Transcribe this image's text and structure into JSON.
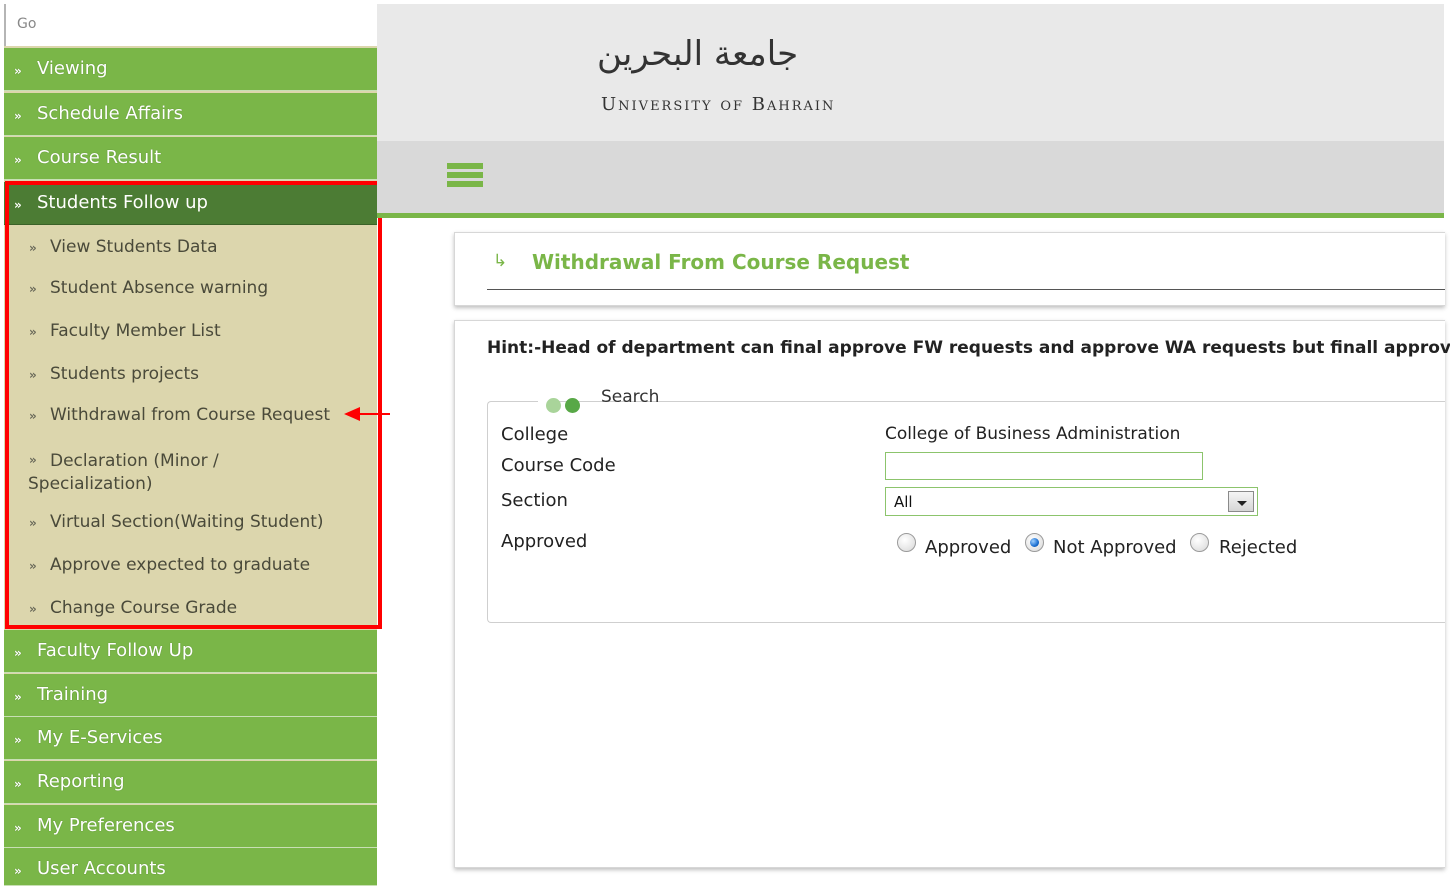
{
  "sidebar": {
    "go_label": "Go",
    "items": [
      {
        "label": "Viewing"
      },
      {
        "label": "Schedule Affairs"
      },
      {
        "label": "Course Result"
      },
      {
        "label": "Students Follow up"
      },
      {
        "label": "Faculty Follow Up"
      },
      {
        "label": "Training"
      },
      {
        "label": "My E-Services"
      },
      {
        "label": "Reporting"
      },
      {
        "label": "My Preferences"
      },
      {
        "label": "User Accounts"
      }
    ],
    "bullet": "»",
    "sub_items": [
      {
        "label": "View Students Data"
      },
      {
        "label": "Student Absence warning"
      },
      {
        "label": "Faculty Member List"
      },
      {
        "label": "Students projects"
      },
      {
        "label": "Withdrawal from Course Request"
      },
      {
        "label": "Declaration (Minor / Specialization)"
      },
      {
        "label": "Virtual Section(Waiting Student)"
      },
      {
        "label": "Approve expected to graduate"
      },
      {
        "label": "Change Course Grade"
      }
    ]
  },
  "header": {
    "arabic_title": "جامعة البحرين",
    "english_title": "University of Bahrain"
  },
  "page": {
    "title_arrow": "↳",
    "title": "Withdrawal From Course Request",
    "hint": "Hint:-Head of department can final approve FW requests and approve WA requests but finall approve"
  },
  "search": {
    "legend": "Search",
    "college_label": "College",
    "college_value": "College of Business Administration",
    "course_code_label": "Course Code",
    "course_code_value": "",
    "section_label": "Section",
    "section_value": "All",
    "approved_label": "Approved",
    "options": [
      {
        "label": "Approved",
        "checked": false
      },
      {
        "label": "Not Approved",
        "checked": true
      },
      {
        "label": "Rejected",
        "checked": false
      }
    ]
  },
  "colors": {
    "menu_green": "#7ab648",
    "active_green": "#4c7c34",
    "submenu_bg": "#dcd6ad",
    "highlight_red": "#ff0000"
  }
}
